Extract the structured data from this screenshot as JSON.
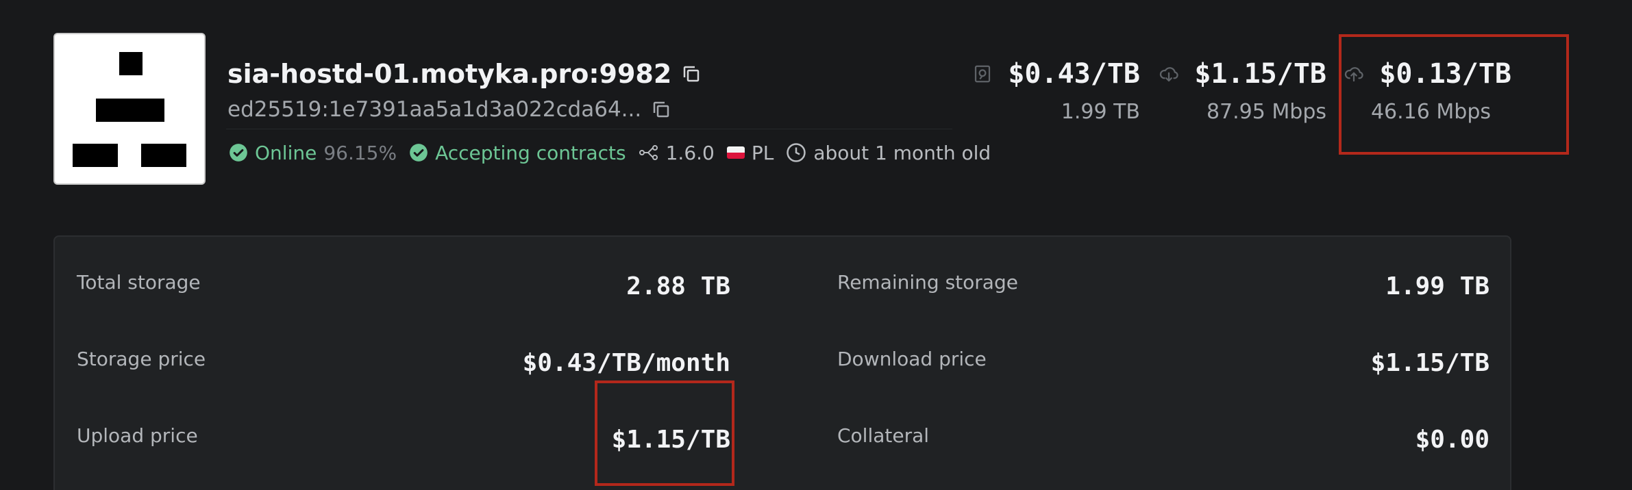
{
  "host": {
    "address": "sia-hostd-01.motyka.pro:9982",
    "public_key": "ed25519:1e7391aa5a1d3a022cda64...",
    "status_label": "Online",
    "uptime": "96.15%",
    "contracts_label": "Accepting contracts",
    "version": "1.6.0",
    "country": "PL",
    "age": "about 1 month old"
  },
  "stats": [
    {
      "icon": "storage-icon",
      "price": "$0.43/TB",
      "sub": "1.99 TB"
    },
    {
      "icon": "download-cloud-icon",
      "price": "$1.15/TB",
      "sub": "87.95 Mbps"
    },
    {
      "icon": "upload-cloud-icon",
      "price": "$0.13/TB",
      "sub": "46.16 Mbps"
    }
  ],
  "details": {
    "total_storage_label": "Total storage",
    "total_storage_value": "2.88 TB",
    "remaining_storage_label": "Remaining storage",
    "remaining_storage_value": "1.99 TB",
    "storage_price_label": "Storage price",
    "storage_price_value": "$0.43/TB/month",
    "download_price_label": "Download price",
    "download_price_value": "$1.15/TB",
    "upload_price_label": "Upload price",
    "upload_price_value": "$1.15/TB",
    "collateral_label": "Collateral",
    "collateral_value": "$0.00"
  },
  "colors": {
    "background": "#18191b",
    "panel": "#202224",
    "accent_green": "#6dc695",
    "highlight_red": "#b3281b"
  }
}
